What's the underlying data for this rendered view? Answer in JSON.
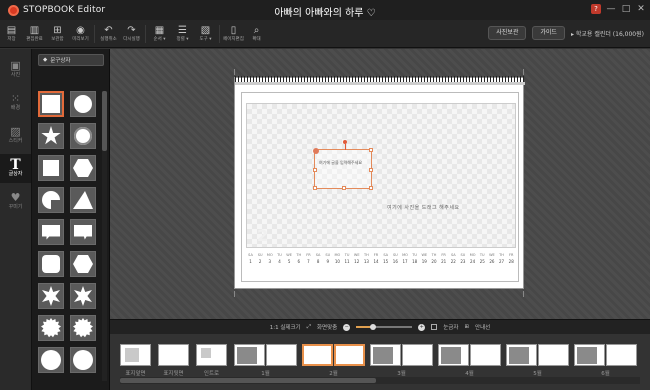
{
  "app": {
    "name": "STOPBOOK Editor",
    "doc_title": "아빠의 아빠와의 하루 ♡"
  },
  "window_controls": {
    "help": "?",
    "minimize": "—",
    "maximize": "□",
    "close": "✕"
  },
  "toolbar": {
    "buttons": [
      {
        "icon": "save-icon",
        "glyph": "▤",
        "label": "저장"
      },
      {
        "icon": "save-as-icon",
        "glyph": "▥",
        "label": "편집완료"
      },
      {
        "icon": "save-copy-icon",
        "glyph": "⊞",
        "label": "보관함"
      },
      {
        "icon": "preview-icon",
        "glyph": "◉",
        "label": "미리보기"
      },
      {
        "icon": "undo-icon",
        "glyph": "↶",
        "label": "실행취소"
      },
      {
        "icon": "redo-icon",
        "glyph": "↷",
        "label": "다시실행"
      },
      {
        "icon": "order-icon",
        "glyph": "▦",
        "label": "순서 ▾"
      },
      {
        "icon": "align-icon",
        "glyph": "☰",
        "label": "정렬 ▾"
      },
      {
        "icon": "tool-icon",
        "glyph": "▧",
        "label": "도구 ▾"
      },
      {
        "icon": "bookmark-icon",
        "glyph": "▯",
        "label": "페이지편집"
      },
      {
        "icon": "zoom-icon",
        "glyph": "⌕",
        "label": "확대"
      }
    ],
    "right": {
      "btn1": "사진보관",
      "btn2": "가이드",
      "link": "▸ 학교용 캘린더 (16,000원)"
    }
  },
  "sidebar": {
    "items": [
      {
        "icon": "camera-icon",
        "glyph": "▣",
        "label": "사진"
      },
      {
        "icon": "grid-icon",
        "glyph": "⁙",
        "label": "배경"
      },
      {
        "icon": "image-icon",
        "glyph": "▨",
        "label": "스티커"
      },
      {
        "icon": "text-icon",
        "glyph": "T",
        "label": "글상자",
        "active": true
      },
      {
        "icon": "heart-icon",
        "glyph": "♥",
        "label": "꾸미기"
      }
    ]
  },
  "panel": {
    "category": "문구상자"
  },
  "shapes": [
    "rect",
    "circle",
    "star",
    "circle-ring",
    "rect-small",
    "hexagon",
    "pac",
    "triangle-fold",
    "speech-rect",
    "speech-left",
    "rounded",
    "hexagon2",
    "burst-star",
    "burst-star2",
    "gear",
    "gear2",
    "burst-round",
    "burst-round2"
  ],
  "page": {
    "page_number": "2",
    "textbox_line1": "여기에 글을 입력해주세요",
    "photo_placeholder": "여기에 사진을 드래그 해주세요",
    "day_names": [
      "SA",
      "SU",
      "MO",
      "TU",
      "WE",
      "TH",
      "FR",
      "SA",
      "SU",
      "MO",
      "TU",
      "WE",
      "TH",
      "FR",
      "SA",
      "SU",
      "MO",
      "TU",
      "WE",
      "TH",
      "FR",
      "SA",
      "SU",
      "MO",
      "TU",
      "WE",
      "TH",
      "FR"
    ],
    "dates": [
      "1",
      "2",
      "3",
      "4",
      "5",
      "6",
      "7",
      "8",
      "9",
      "10",
      "11",
      "12",
      "13",
      "14",
      "15",
      "16",
      "17",
      "18",
      "19",
      "20",
      "21",
      "22",
      "23",
      "24",
      "25",
      "26",
      "27",
      "28"
    ]
  },
  "bottombar": {
    "pages_btn": "1:1 실제크기",
    "fit_btn": "화면맞춤",
    "zoom_level": 0.3,
    "guide": "눈금자",
    "grid": "안내선"
  },
  "filmstrip": [
    {
      "caption": "표지앞면",
      "type": "single-photo"
    },
    {
      "caption": "표지뒷면",
      "type": "blank"
    },
    {
      "caption": "인트로",
      "type": "single-small"
    },
    {
      "caption": "1월",
      "type": "spread-photo"
    },
    {
      "caption": "2월",
      "type": "spread-blank",
      "selected": true
    },
    {
      "caption": "3월",
      "type": "spread-photo"
    },
    {
      "caption": "4월",
      "type": "spread-photo"
    },
    {
      "caption": "5월",
      "type": "spread-photo"
    },
    {
      "caption": "6월",
      "type": "spread-photo"
    }
  ],
  "scroll": {
    "horizontal_position": 0.0
  }
}
